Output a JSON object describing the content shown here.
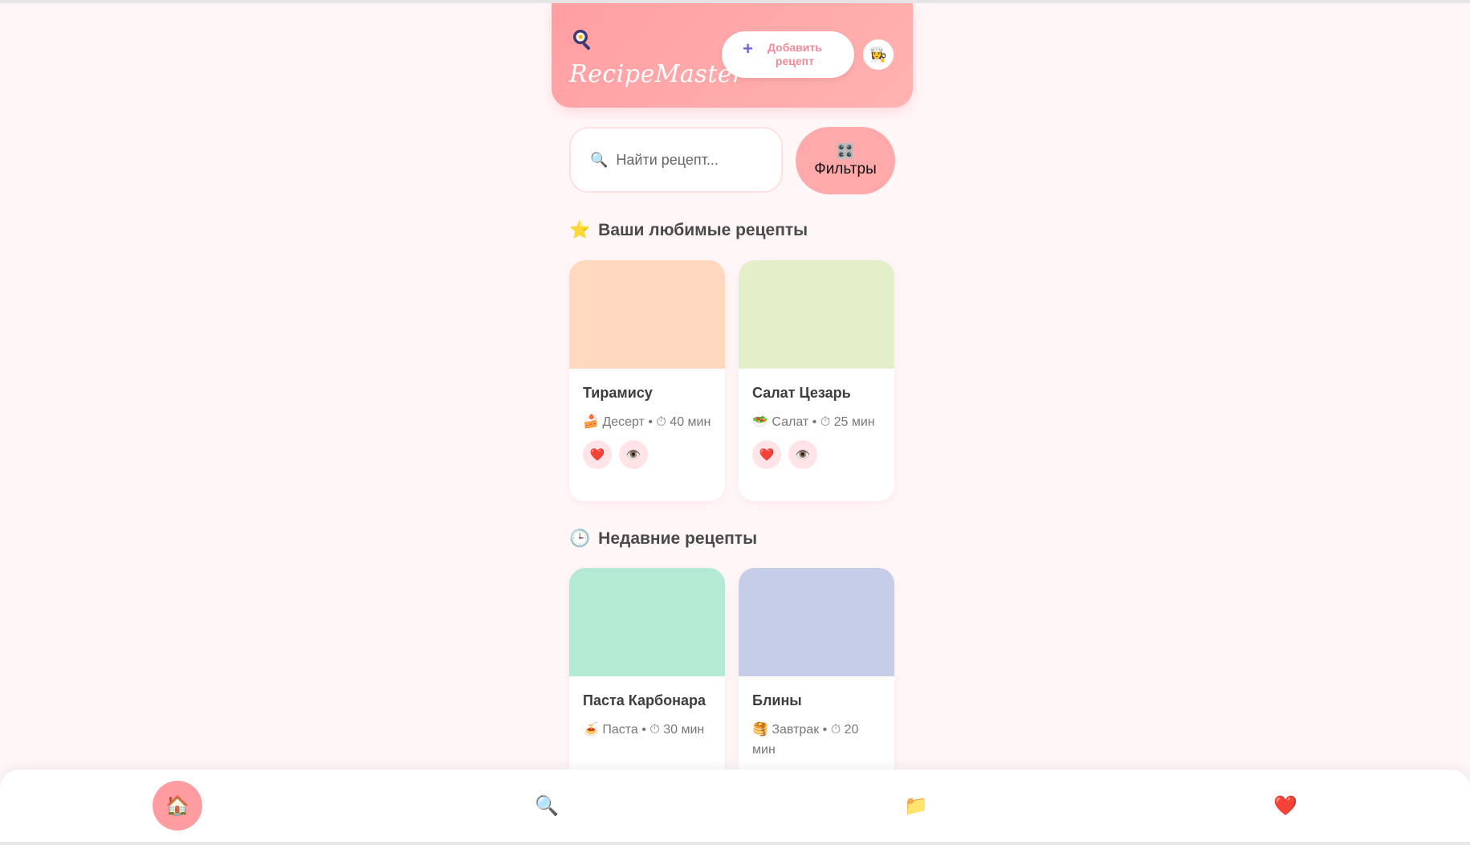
{
  "app": {
    "title": "RecipeMaster",
    "logo_icon": "frying-pan-icon"
  },
  "header": {
    "add_icon": "+",
    "add_label": "Добавить рецепт",
    "avatar_icon": "👩‍🍳"
  },
  "search": {
    "icon": "🔍",
    "placeholder": "Найти рецепт..."
  },
  "filters": {
    "icon": "🎛️",
    "label": "Фильтры"
  },
  "favorites": {
    "icon": "⭐",
    "title": "Ваши любимые рецепты",
    "items": [
      {
        "name": "Тирамису",
        "meta": "🍰 Десерт • ⏱ 40 мин",
        "color": "#ffd8bd",
        "like_icon": "❤️",
        "view_icon": "👁️"
      },
      {
        "name": "Салат Цезарь",
        "meta": "🥗 Салат • ⏱ 25 мин",
        "color": "#e2efc9",
        "like_icon": "❤️",
        "view_icon": "👁️"
      }
    ]
  },
  "recent": {
    "icon": "🕒",
    "title": "Недавние рецепты",
    "items": [
      {
        "name": "Паста Карбонара",
        "meta": "🍝 Паста • ⏱ 30 мин",
        "color": "#b4e9d4"
      },
      {
        "name": "Блины",
        "meta": "🥞 Завтрак • ⏱ 20 мин",
        "color": "#c6cde8"
      }
    ]
  },
  "nav": {
    "items": [
      {
        "name": "home",
        "icon": "🏠",
        "active": true
      },
      {
        "name": "search",
        "icon": "🔍",
        "active": false
      },
      {
        "name": "folder",
        "icon": "📁",
        "active": false
      },
      {
        "name": "favorites",
        "icon": "❤️",
        "active": false
      }
    ]
  }
}
